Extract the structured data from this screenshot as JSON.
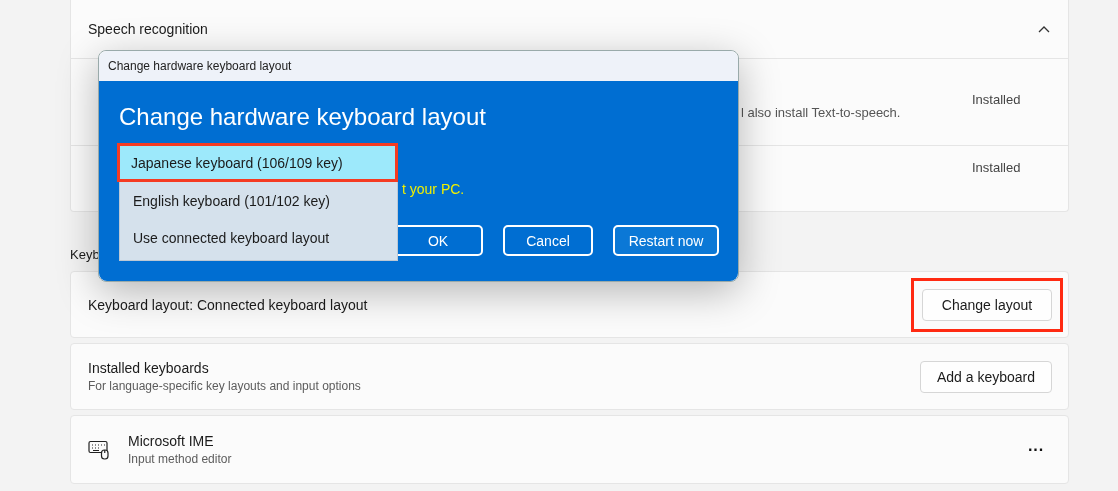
{
  "speech_card": {
    "title": "Speech recognition",
    "expanded": true,
    "rows": [
      {
        "description": "l also install Text-to-speech.",
        "status": "Installed"
      },
      {
        "status": "Installed"
      }
    ]
  },
  "section_heading": "Keyb",
  "keyboard_layout": {
    "label": "Keyboard layout: Connected keyboard layout",
    "button": "Change layout",
    "highlighted": true
  },
  "installed_keyboards": {
    "title": "Installed keyboards",
    "subtitle": "For language-specific key layouts and input options",
    "button": "Add a keyboard"
  },
  "ime": {
    "title": "Microsoft IME",
    "subtitle": "Input method editor",
    "more": "···"
  },
  "dialog": {
    "window_title": "Change hardware keyboard layout",
    "heading": "Change hardware keyboard layout",
    "message": "t your PC.",
    "options": [
      {
        "label": "Japanese keyboard (106/109 key)",
        "selected": true,
        "highlighted": true
      },
      {
        "label": "English keyboard (101/102 key)",
        "selected": false,
        "highlighted": false
      },
      {
        "label": "Use connected keyboard layout",
        "selected": false,
        "highlighted": false
      }
    ],
    "buttons": [
      "OK",
      "Cancel",
      "Restart now"
    ]
  }
}
